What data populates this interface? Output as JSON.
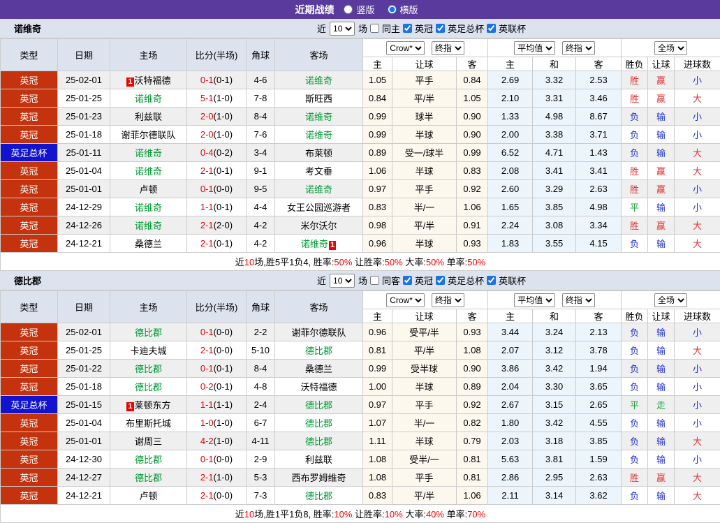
{
  "header": {
    "title": "近期战绩",
    "radio_vertical": "竖版",
    "radio_horizontal": "横版"
  },
  "tables": [
    {
      "team": "诺维奇",
      "controls": {
        "near": "近",
        "count": "10",
        "games": "场",
        "same": "同主",
        "leagues": [
          "英冠",
          "英足总杯",
          "英联杯"
        ]
      },
      "selects": {
        "company": "Crow*",
        "company_kind": "终指",
        "avg": "平均值",
        "avg_kind": "终指",
        "scope": "全场"
      },
      "cols": {
        "type": "类型",
        "date": "日期",
        "home": "主场",
        "score": "比分(半场)",
        "corner": "角球",
        "away": "客场",
        "let_home": "主",
        "let": "让球",
        "let_away": "客",
        "avg_home": "主",
        "avg_draw": "和",
        "avg_away": "客",
        "res": "胜负",
        "res_let": "让球",
        "goals": "进球数"
      },
      "rows": [
        {
          "type": "英冠",
          "type_cls": "champ",
          "date": "25-02-01",
          "hb_pre": "1",
          "home": "沃特福德",
          "home_cls": "",
          "hb_post": "",
          "score": "0-1",
          "half": "(0-1)",
          "corner": "4-6",
          "ab_pre": "",
          "away": "诺维奇",
          "away_cls": "self",
          "ab_post": "",
          "hh": "1.05",
          "hc": "平手",
          "ha": "0.84",
          "oh": "2.69",
          "od": "3.32",
          "oa": "2.53",
          "res": "胜",
          "res_c": "r",
          "hres": "赢",
          "hres_c": "r",
          "ou": "小",
          "ou_c": "b"
        },
        {
          "type": "英冠",
          "type_cls": "champ",
          "date": "25-01-25",
          "hb_pre": "",
          "home": "诺维奇",
          "home_cls": "self",
          "hb_post": "",
          "score": "5-1",
          "half": "(1-0)",
          "corner": "7-8",
          "ab_pre": "",
          "away": "斯旺西",
          "away_cls": "",
          "ab_post": "",
          "hh": "0.84",
          "hc": "平/半",
          "ha": "1.05",
          "oh": "2.10",
          "od": "3.31",
          "oa": "3.46",
          "res": "胜",
          "res_c": "r",
          "hres": "赢",
          "hres_c": "r",
          "ou": "大",
          "ou_c": "r"
        },
        {
          "type": "英冠",
          "type_cls": "champ",
          "date": "25-01-23",
          "hb_pre": "",
          "home": "利兹联",
          "home_cls": "",
          "hb_post": "",
          "score": "2-0",
          "half": "(1-0)",
          "corner": "8-4",
          "ab_pre": "",
          "away": "诺维奇",
          "away_cls": "self",
          "ab_post": "",
          "hh": "0.99",
          "hc": "球半",
          "ha": "0.90",
          "oh": "1.33",
          "od": "4.98",
          "oa": "8.67",
          "res": "负",
          "res_c": "b",
          "hres": "输",
          "hres_c": "b",
          "ou": "小",
          "ou_c": "b"
        },
        {
          "type": "英冠",
          "type_cls": "champ",
          "date": "25-01-18",
          "hb_pre": "",
          "home": "谢菲尔德联队",
          "home_cls": "",
          "hb_post": "",
          "score": "2-0",
          "half": "(1-0)",
          "corner": "7-6",
          "ab_pre": "",
          "away": "诺维奇",
          "away_cls": "self",
          "ab_post": "",
          "hh": "0.99",
          "hc": "半球",
          "ha": "0.90",
          "oh": "2.00",
          "od": "3.38",
          "oa": "3.71",
          "res": "负",
          "res_c": "b",
          "hres": "输",
          "hres_c": "b",
          "ou": "小",
          "ou_c": "b"
        },
        {
          "type": "英足总杯",
          "type_cls": "facup",
          "date": "25-01-11",
          "hb_pre": "",
          "home": "诺维奇",
          "home_cls": "self",
          "hb_post": "",
          "score": "0-4",
          "half": "(0-2)",
          "corner": "3-4",
          "ab_pre": "",
          "away": "布莱顿",
          "away_cls": "",
          "ab_post": "",
          "hh": "0.89",
          "hc": "受一/球半",
          "ha": "0.99",
          "oh": "6.52",
          "od": "4.71",
          "oa": "1.43",
          "res": "负",
          "res_c": "b",
          "hres": "输",
          "hres_c": "b",
          "ou": "大",
          "ou_c": "r"
        },
        {
          "type": "英冠",
          "type_cls": "champ",
          "date": "25-01-04",
          "hb_pre": "",
          "home": "诺维奇",
          "home_cls": "self",
          "hb_post": "",
          "score": "2-1",
          "half": "(0-1)",
          "corner": "9-1",
          "ab_pre": "",
          "away": "考文垂",
          "away_cls": "",
          "ab_post": "",
          "hh": "1.06",
          "hc": "半球",
          "ha": "0.83",
          "oh": "2.08",
          "od": "3.41",
          "oa": "3.41",
          "res": "胜",
          "res_c": "r",
          "hres": "赢",
          "hres_c": "r",
          "ou": "大",
          "ou_c": "r"
        },
        {
          "type": "英冠",
          "type_cls": "champ",
          "date": "25-01-01",
          "hb_pre": "",
          "home": "卢顿",
          "home_cls": "",
          "hb_post": "",
          "score": "0-1",
          "half": "(0-0)",
          "corner": "9-5",
          "ab_pre": "",
          "away": "诺维奇",
          "away_cls": "self",
          "ab_post": "",
          "hh": "0.97",
          "hc": "平手",
          "ha": "0.92",
          "oh": "2.60",
          "od": "3.29",
          "oa": "2.63",
          "res": "胜",
          "res_c": "r",
          "hres": "赢",
          "hres_c": "r",
          "ou": "小",
          "ou_c": "b"
        },
        {
          "type": "英冠",
          "type_cls": "champ",
          "date": "24-12-29",
          "hb_pre": "",
          "home": "诺维奇",
          "home_cls": "self",
          "hb_post": "",
          "score": "1-1",
          "half": "(0-1)",
          "corner": "4-4",
          "ab_pre": "",
          "away": "女王公园巡游者",
          "away_cls": "",
          "ab_post": "",
          "hh": "0.83",
          "hc": "半/一",
          "ha": "1.06",
          "oh": "1.65",
          "od": "3.85",
          "oa": "4.98",
          "res": "平",
          "res_c": "g",
          "hres": "输",
          "hres_c": "b",
          "ou": "小",
          "ou_c": "b"
        },
        {
          "type": "英冠",
          "type_cls": "champ",
          "date": "24-12-26",
          "hb_pre": "",
          "home": "诺维奇",
          "home_cls": "self",
          "hb_post": "",
          "score": "2-1",
          "half": "(2-0)",
          "corner": "4-2",
          "ab_pre": "",
          "away": "米尔沃尔",
          "away_cls": "",
          "ab_post": "",
          "hh": "0.98",
          "hc": "平/半",
          "ha": "0.91",
          "oh": "2.24",
          "od": "3.08",
          "oa": "3.34",
          "res": "胜",
          "res_c": "r",
          "hres": "赢",
          "hres_c": "r",
          "ou": "大",
          "ou_c": "r"
        },
        {
          "type": "英冠",
          "type_cls": "champ",
          "date": "24-12-21",
          "hb_pre": "",
          "home": "桑德兰",
          "home_cls": "",
          "hb_post": "",
          "score": "2-1",
          "half": "(0-1)",
          "corner": "4-2",
          "ab_pre": "",
          "away": "诺维奇",
          "away_cls": "self",
          "ab_post": "1",
          "hh": "0.96",
          "hc": "半球",
          "ha": "0.93",
          "oh": "1.83",
          "od": "3.55",
          "oa": "4.15",
          "res": "负",
          "res_c": "b",
          "hres": "输",
          "hres_c": "b",
          "ou": "大",
          "ou_c": "r"
        }
      ],
      "summary": [
        {
          "t": "近",
          "c": "k"
        },
        {
          "t": "10",
          "c": "r"
        },
        {
          "t": "场,胜5平1负4, 胜率:",
          "c": "k"
        },
        {
          "t": "50%",
          "c": "r"
        },
        {
          "t": " 让胜率:",
          "c": "k"
        },
        {
          "t": "50%",
          "c": "r"
        },
        {
          "t": " 大率:",
          "c": "k"
        },
        {
          "t": "50%",
          "c": "r"
        },
        {
          "t": " 单率:",
          "c": "k"
        },
        {
          "t": "50%",
          "c": "r"
        }
      ]
    },
    {
      "team": "德比郡",
      "controls": {
        "near": "近",
        "count": "10",
        "games": "场",
        "same": "同客",
        "leagues": [
          "英冠",
          "英足总杯",
          "英联杯"
        ]
      },
      "selects": {
        "company": "Crow*",
        "company_kind": "终指",
        "avg": "平均值",
        "avg_kind": "终指",
        "scope": "全场"
      },
      "cols": {
        "type": "类型",
        "date": "日期",
        "home": "主场",
        "score": "比分(半场)",
        "corner": "角球",
        "away": "客场",
        "let_home": "主",
        "let": "让球",
        "let_away": "客",
        "avg_home": "主",
        "avg_draw": "和",
        "avg_away": "客",
        "res": "胜负",
        "res_let": "让球",
        "goals": "进球数"
      },
      "rows": [
        {
          "type": "英冠",
          "type_cls": "champ",
          "date": "25-02-01",
          "hb_pre": "",
          "home": "德比郡",
          "home_cls": "self",
          "hb_post": "",
          "score": "0-1",
          "half": "(0-0)",
          "corner": "2-2",
          "ab_pre": "",
          "away": "谢菲尔德联队",
          "away_cls": "",
          "ab_post": "",
          "hh": "0.96",
          "hc": "受平/半",
          "ha": "0.93",
          "oh": "3.44",
          "od": "3.24",
          "oa": "2.13",
          "res": "负",
          "res_c": "b",
          "hres": "输",
          "hres_c": "b",
          "ou": "小",
          "ou_c": "b"
        },
        {
          "type": "英冠",
          "type_cls": "champ",
          "date": "25-01-25",
          "hb_pre": "",
          "home": "卡迪夫城",
          "home_cls": "",
          "hb_post": "",
          "score": "2-1",
          "half": "(0-0)",
          "corner": "5-10",
          "ab_pre": "",
          "away": "德比郡",
          "away_cls": "self",
          "ab_post": "",
          "hh": "0.81",
          "hc": "平/半",
          "ha": "1.08",
          "oh": "2.07",
          "od": "3.12",
          "oa": "3.78",
          "res": "负",
          "res_c": "b",
          "hres": "输",
          "hres_c": "b",
          "ou": "大",
          "ou_c": "r"
        },
        {
          "type": "英冠",
          "type_cls": "champ",
          "date": "25-01-22",
          "hb_pre": "",
          "home": "德比郡",
          "home_cls": "self",
          "hb_post": "",
          "score": "0-1",
          "half": "(0-1)",
          "corner": "8-4",
          "ab_pre": "",
          "away": "桑德兰",
          "away_cls": "",
          "ab_post": "",
          "hh": "0.99",
          "hc": "受半球",
          "ha": "0.90",
          "oh": "3.86",
          "od": "3.42",
          "oa": "1.94",
          "res": "负",
          "res_c": "b",
          "hres": "输",
          "hres_c": "b",
          "ou": "小",
          "ou_c": "b"
        },
        {
          "type": "英冠",
          "type_cls": "champ",
          "date": "25-01-18",
          "hb_pre": "",
          "home": "德比郡",
          "home_cls": "self",
          "hb_post": "",
          "score": "0-2",
          "half": "(0-1)",
          "corner": "4-8",
          "ab_pre": "",
          "away": "沃特福德",
          "away_cls": "",
          "ab_post": "",
          "hh": "1.00",
          "hc": "半球",
          "ha": "0.89",
          "oh": "2.04",
          "od": "3.30",
          "oa": "3.65",
          "res": "负",
          "res_c": "b",
          "hres": "输",
          "hres_c": "b",
          "ou": "小",
          "ou_c": "b"
        },
        {
          "type": "英足总杯",
          "type_cls": "facup",
          "date": "25-01-15",
          "hb_pre": "1",
          "home": "莱顿东方",
          "home_cls": "",
          "hb_post": "",
          "score": "1-1",
          "half": "(1-1)",
          "corner": "2-4",
          "ab_pre": "",
          "away": "德比郡",
          "away_cls": "self",
          "ab_post": "",
          "hh": "0.97",
          "hc": "平手",
          "ha": "0.92",
          "oh": "2.67",
          "od": "3.15",
          "oa": "2.65",
          "res": "平",
          "res_c": "g",
          "hres": "走",
          "hres_c": "g",
          "ou": "小",
          "ou_c": "b"
        },
        {
          "type": "英冠",
          "type_cls": "champ",
          "date": "25-01-04",
          "hb_pre": "",
          "home": "布里斯托城",
          "home_cls": "",
          "hb_post": "",
          "score": "1-0",
          "half": "(1-0)",
          "corner": "6-7",
          "ab_pre": "",
          "away": "德比郡",
          "away_cls": "self",
          "ab_post": "",
          "hh": "1.07",
          "hc": "半/一",
          "ha": "0.82",
          "oh": "1.80",
          "od": "3.42",
          "oa": "4.55",
          "res": "负",
          "res_c": "b",
          "hres": "输",
          "hres_c": "b",
          "ou": "小",
          "ou_c": "b"
        },
        {
          "type": "英冠",
          "type_cls": "champ",
          "date": "25-01-01",
          "hb_pre": "",
          "home": "谢周三",
          "home_cls": "",
          "hb_post": "",
          "score": "4-2",
          "half": "(1-0)",
          "corner": "4-11",
          "ab_pre": "",
          "away": "德比郡",
          "away_cls": "self",
          "ab_post": "",
          "hh": "1.11",
          "hc": "半球",
          "ha": "0.79",
          "oh": "2.03",
          "od": "3.18",
          "oa": "3.85",
          "res": "负",
          "res_c": "b",
          "hres": "输",
          "hres_c": "b",
          "ou": "大",
          "ou_c": "r"
        },
        {
          "type": "英冠",
          "type_cls": "champ",
          "date": "24-12-30",
          "hb_pre": "",
          "home": "德比郡",
          "home_cls": "self",
          "hb_post": "",
          "score": "0-1",
          "half": "(0-0)",
          "corner": "2-9",
          "ab_pre": "",
          "away": "利兹联",
          "away_cls": "",
          "ab_post": "",
          "hh": "1.08",
          "hc": "受半/一",
          "ha": "0.81",
          "oh": "5.63",
          "od": "3.81",
          "oa": "1.59",
          "res": "负",
          "res_c": "b",
          "hres": "输",
          "hres_c": "b",
          "ou": "小",
          "ou_c": "b"
        },
        {
          "type": "英冠",
          "type_cls": "champ",
          "date": "24-12-27",
          "hb_pre": "",
          "home": "德比郡",
          "home_cls": "self",
          "hb_post": "",
          "score": "2-1",
          "half": "(1-0)",
          "corner": "5-3",
          "ab_pre": "",
          "away": "西布罗姆维奇",
          "away_cls": "",
          "ab_post": "",
          "hh": "1.08",
          "hc": "平手",
          "ha": "0.81",
          "oh": "2.86",
          "od": "2.95",
          "oa": "2.63",
          "res": "胜",
          "res_c": "r",
          "hres": "赢",
          "hres_c": "r",
          "ou": "大",
          "ou_c": "r"
        },
        {
          "type": "英冠",
          "type_cls": "champ",
          "date": "24-12-21",
          "hb_pre": "",
          "home": "卢顿",
          "home_cls": "",
          "hb_post": "",
          "score": "2-1",
          "half": "(0-0)",
          "corner": "7-3",
          "ab_pre": "",
          "away": "德比郡",
          "away_cls": "self",
          "ab_post": "",
          "hh": "0.83",
          "hc": "平/半",
          "ha": "1.06",
          "oh": "2.11",
          "od": "3.14",
          "oa": "3.62",
          "res": "负",
          "res_c": "b",
          "hres": "输",
          "hres_c": "b",
          "ou": "大",
          "ou_c": "r"
        }
      ],
      "summary": [
        {
          "t": "近",
          "c": "k"
        },
        {
          "t": "10",
          "c": "r"
        },
        {
          "t": "场,胜1平1负8, 胜率:",
          "c": "k"
        },
        {
          "t": "10%",
          "c": "r"
        },
        {
          "t": " 让胜率:",
          "c": "k"
        },
        {
          "t": "10%",
          "c": "r"
        },
        {
          "t": " 大率:",
          "c": "k"
        },
        {
          "t": "40%",
          "c": "r"
        },
        {
          "t": " 单率:",
          "c": "k"
        },
        {
          "t": "70%",
          "c": "r"
        }
      ]
    }
  ]
}
